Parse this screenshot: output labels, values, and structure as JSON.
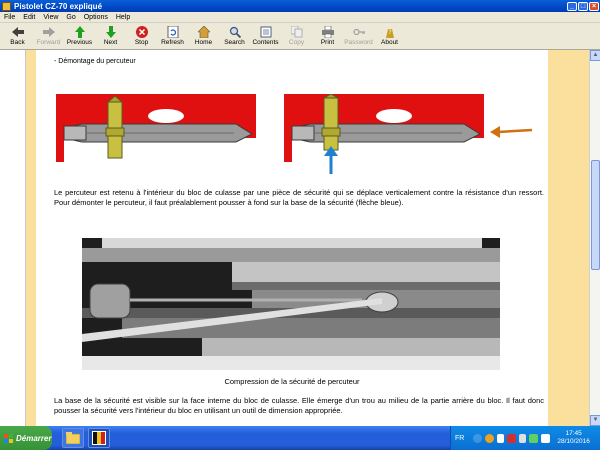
{
  "window": {
    "title": "Pistolet CZ-70 expliqué",
    "controls": [
      "_",
      "□",
      "×"
    ]
  },
  "menu": [
    "File",
    "Edit",
    "View",
    "Go",
    "Options",
    "Help"
  ],
  "toolbar": [
    {
      "label": "Back",
      "icon": "back-arrow-icon",
      "enabled": true
    },
    {
      "label": "Forward",
      "icon": "forward-arrow-icon",
      "enabled": false
    },
    {
      "label": "Previous",
      "icon": "up-arrow-icon",
      "enabled": true
    },
    {
      "label": "Next",
      "icon": "down-arrow-icon",
      "enabled": true
    },
    {
      "label": "Stop",
      "icon": "stop-icon",
      "enabled": true
    },
    {
      "label": "Refresh",
      "icon": "refresh-icon",
      "enabled": true
    },
    {
      "label": "Home",
      "icon": "home-icon",
      "enabled": true
    },
    {
      "label": "Search",
      "icon": "search-icon",
      "enabled": true
    },
    {
      "label": "Contents",
      "icon": "contents-icon",
      "enabled": true
    },
    {
      "label": "Copy",
      "icon": "copy-icon",
      "enabled": false
    },
    {
      "label": "Print",
      "icon": "print-icon",
      "enabled": true
    },
    {
      "label": "Password",
      "icon": "key-icon",
      "enabled": false
    },
    {
      "label": "About",
      "icon": "question-icon",
      "enabled": true
    }
  ],
  "document": {
    "section_title": "- Démontage du percuteur",
    "paragraph1": "Le percuteur est retenu à l'intérieur du bloc de culasse par une pièce de sécurité qui se déplace verticalement contre la résistance d'un ressort. Pour démonter le percuteur, il faut préalablement pousser à fond sur la base de la sécurité (flèche bleue).",
    "photo_caption": "Compression de la sécurité de percuteur",
    "paragraph2": "La base de la sécurité est visible sur la face interne du bloc de culasse. Elle émerge d'un trou au milieu de la partie arrière du bloc. Il faut donc pousser la sécurité vers l'intérieur du bloc en utilisant un outil de dimension appropriée."
  },
  "taskbar": {
    "start_label": "Démarrer",
    "language": "FR",
    "time": "17:45",
    "date": "28/10/2016"
  },
  "colors": {
    "page_bg": "#fbdf9c",
    "diagram_red": "#e01010",
    "safety_yellow": "#c8c040",
    "arrow_blue": "#2080d0",
    "arrow_orange": "#d07010"
  }
}
